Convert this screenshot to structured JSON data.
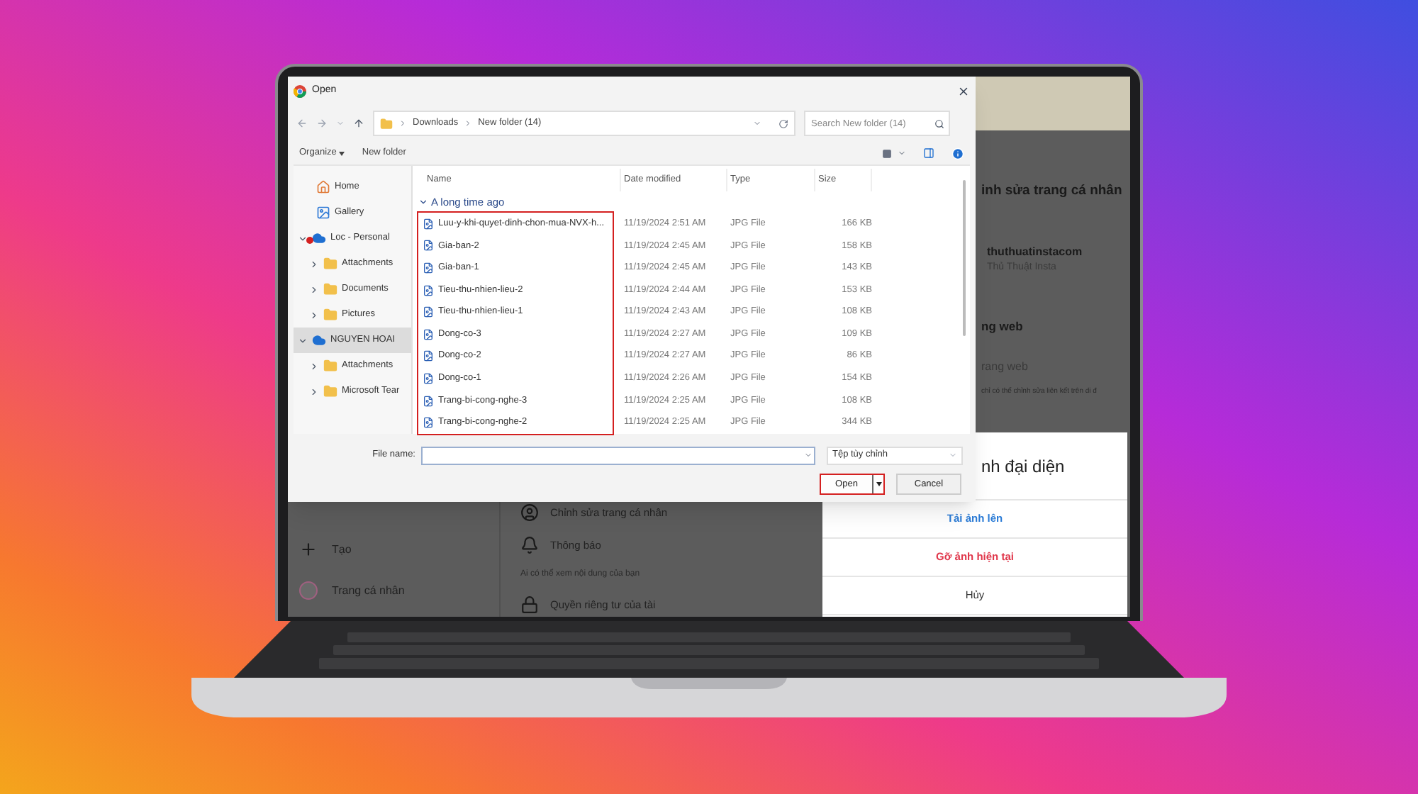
{
  "dialog": {
    "title": "Open",
    "path": [
      "Downloads",
      "New folder (14)"
    ],
    "search": {
      "placeholder": "Search New folder (14)"
    },
    "toolbar": [
      {
        "label": "Organize",
        "kind": "menu"
      },
      {
        "label": "New folder",
        "kind": "button"
      }
    ],
    "sidebar": [
      {
        "label": "Home",
        "kind": "home",
        "selected": false
      },
      {
        "label": "Gallery",
        "kind": "gallery",
        "selected": false
      },
      {
        "label": "Loc - Personal",
        "kind": "cloud",
        "expanded": true,
        "sync_error": true,
        "selected": false,
        "children": [
          {
            "label": "Attachments",
            "kind": "folder",
            "expanded": false,
            "selected": false
          },
          {
            "label": "Documents",
            "kind": "folder",
            "expanded": false,
            "selected": false
          },
          {
            "label": "Pictures",
            "kind": "folder",
            "expanded": false,
            "selected": false
          }
        ]
      },
      {
        "label": "NGUYEN HOAI",
        "kind": "cloud",
        "expanded": true,
        "sync_error": false,
        "selected": true,
        "children": [
          {
            "label": "Attachments",
            "kind": "folder",
            "expanded": false,
            "selected": false
          },
          {
            "label": "Microsoft Tear",
            "kind": "folder",
            "expanded": false,
            "selected": false
          }
        ]
      }
    ],
    "columns": [
      "Name",
      "Date modified",
      "Type",
      "Size"
    ],
    "group": {
      "label": "A long time ago",
      "expanded": true
    },
    "names_highlighted": true,
    "files": [
      {
        "name": "Luu-y-khi-quyet-dinh-chon-mua-NVX-h...",
        "date": "11/19/2024 2:51 AM",
        "type": "JPG File",
        "size": "166 KB"
      },
      {
        "name": "Gia-ban-2",
        "date": "11/19/2024 2:45 AM",
        "type": "JPG File",
        "size": "158 KB"
      },
      {
        "name": "Gia-ban-1",
        "date": "11/19/2024 2:45 AM",
        "type": "JPG File",
        "size": "143 KB"
      },
      {
        "name": "Tieu-thu-nhien-lieu-2",
        "date": "11/19/2024 2:44 AM",
        "type": "JPG File",
        "size": "153 KB"
      },
      {
        "name": "Tieu-thu-nhien-lieu-1",
        "date": "11/19/2024 2:43 AM",
        "type": "JPG File",
        "size": "108 KB"
      },
      {
        "name": "Dong-co-3",
        "date": "11/19/2024 2:27 AM",
        "type": "JPG File",
        "size": "109 KB"
      },
      {
        "name": "Dong-co-2",
        "date": "11/19/2024 2:27 AM",
        "type": "JPG File",
        "size": "86 KB"
      },
      {
        "name": "Dong-co-1",
        "date": "11/19/2024 2:26 AM",
        "type": "JPG File",
        "size": "154 KB"
      },
      {
        "name": "Trang-bi-cong-nghe-3",
        "date": "11/19/2024 2:25 AM",
        "type": "JPG File",
        "size": "108 KB"
      },
      {
        "name": "Trang-bi-cong-nghe-2",
        "date": "11/19/2024 2:25 AM",
        "type": "JPG File",
        "size": "344 KB"
      }
    ],
    "file_name": {
      "label": "File name:"
    },
    "filter": "Tệp tùy chỉnh",
    "buttons": [
      {
        "label": "Open",
        "kind": "split",
        "highlighted": true
      },
      {
        "label": "Cancel",
        "kind": "plain",
        "highlighted": false
      }
    ]
  },
  "nav": [
    {
      "label": "Tạo",
      "kind": "plus"
    },
    {
      "label": "Trang cá nhân",
      "kind": "avatar"
    }
  ],
  "settings_menu": [
    {
      "label": "Chỉnh sửa trang cá nhân",
      "kind": "person"
    },
    {
      "label": "Thông báo",
      "kind": "bell"
    },
    {
      "label": "Ai có thể xem nội dung của bạn",
      "kind": "section"
    },
    {
      "label": "Quyền riêng tư của tài",
      "kind": "lock"
    }
  ],
  "edit_panel": {
    "heading": "inh sửa trang cá nhân",
    "username": "thuthuatinstacom",
    "full_name": "Thủ Thuật Insta",
    "website_heading": "ng web",
    "website_field": "rang web",
    "website_note": "chỉ có thể chỉnh sửa liên kết trên di đ"
  },
  "photo_sheet": {
    "title": "nh đại diện",
    "actions": [
      {
        "label": "Tải ảnh lên",
        "kind": "primary"
      },
      {
        "label": "Gỡ ảnh hiện tại",
        "kind": "destructive"
      },
      {
        "label": "Hủy",
        "kind": "plain"
      }
    ]
  }
}
